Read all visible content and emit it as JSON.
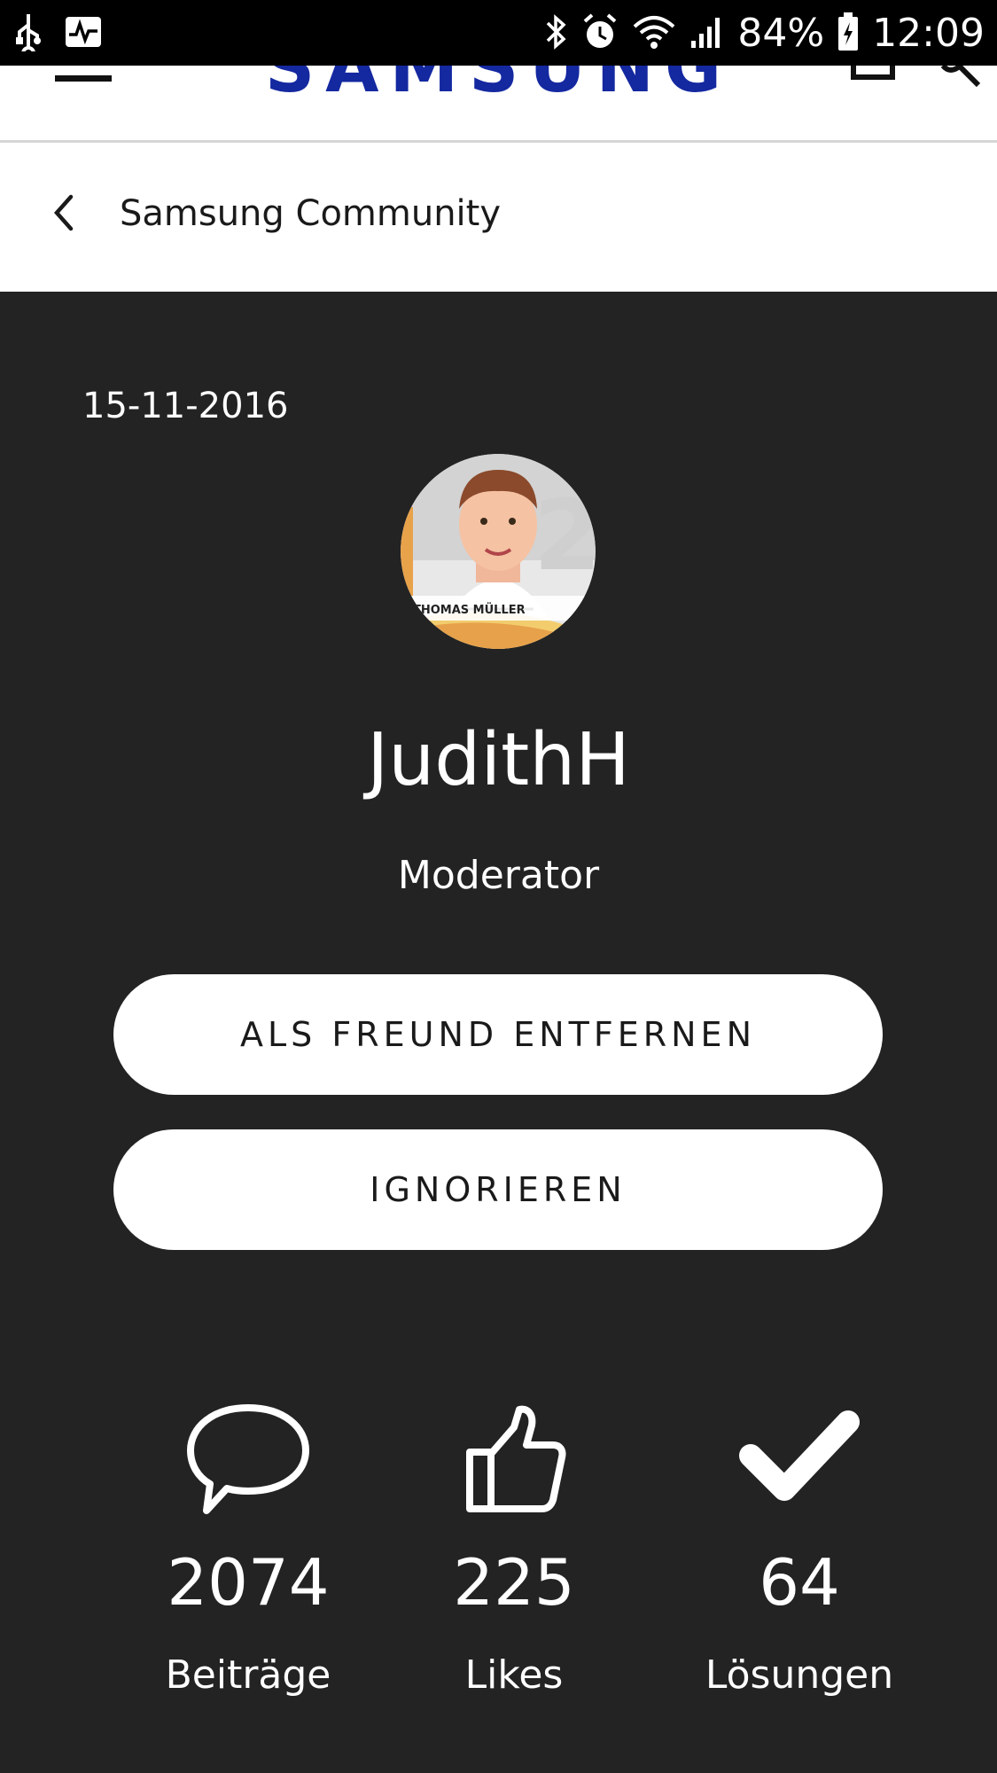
{
  "status_bar": {
    "battery": "84%",
    "time": "12:09",
    "icons": [
      "usb-icon",
      "activity-icon",
      "bluetooth-icon",
      "alarm-icon",
      "wifi-icon",
      "signal-icon",
      "battery-icon"
    ]
  },
  "header": {
    "brand": "SAMSUNG",
    "brand_color": "#1428a0"
  },
  "breadcrumb": {
    "label": "Samsung Community"
  },
  "profile": {
    "join_date": "15-11-2016",
    "avatar_caption": "THOMAS MÜLLER",
    "username": "JudithH",
    "role": "Moderator"
  },
  "actions": {
    "remove_friend": "ALS FREUND ENTFERNEN",
    "ignore": "IGNORIEREN"
  },
  "stats": {
    "posts": {
      "value": "2074",
      "label": "Beiträge"
    },
    "likes": {
      "value": "225",
      "label": "Likes"
    },
    "solutions": {
      "value": "64",
      "label": "Lösungen"
    }
  },
  "colors": {
    "background": "#232323",
    "accent": "#1428a0"
  }
}
